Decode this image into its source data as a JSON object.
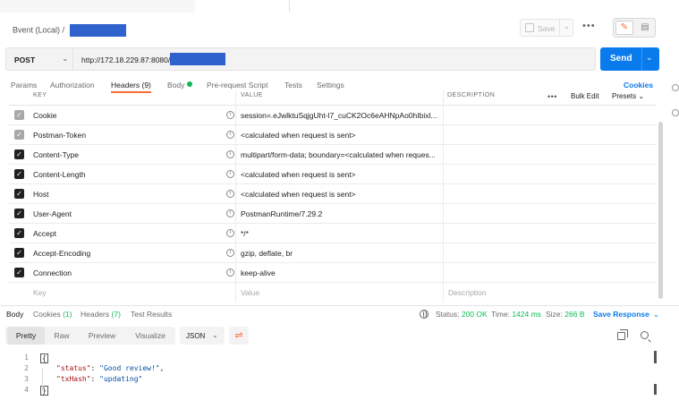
{
  "breadcrumb": {
    "collection": "Bvent (Local)",
    "separator": "/"
  },
  "toolbar": {
    "save_label": "Save"
  },
  "request": {
    "method": "POST",
    "url": "http://172.18.229.87:8080/"
  },
  "send_label": "Send",
  "request_tabs": {
    "params": "Params",
    "authorization": "Authorization",
    "headers": "Headers (9)",
    "body": "Body",
    "prerequest": "Pre-request Script",
    "tests": "Tests",
    "settings": "Settings",
    "cookies": "Cookies"
  },
  "table": {
    "columns": {
      "key": "KEY",
      "value": "VALUE",
      "description": "DESCRIPTION",
      "bulk_edit": "Bulk Edit",
      "presets": "Presets"
    },
    "rows": [
      {
        "key": "Cookie",
        "value": "session=.eJwlktuSqjgUht-l7_cuCK2Oc6eAHNpAo0hIbixl...",
        "enabled": true,
        "auto": true
      },
      {
        "key": "Postman-Token",
        "value": "<calculated when request is sent>",
        "enabled": true,
        "auto": true
      },
      {
        "key": "Content-Type",
        "value": "multipart/form-data; boundary=<calculated when reques...",
        "enabled": true,
        "auto": false
      },
      {
        "key": "Content-Length",
        "value": "<calculated when request is sent>",
        "enabled": true,
        "auto": false
      },
      {
        "key": "Host",
        "value": "<calculated when request is sent>",
        "enabled": true,
        "auto": false
      },
      {
        "key": "User-Agent",
        "value": "PostmanRuntime/7.29.2",
        "enabled": true,
        "auto": false
      },
      {
        "key": "Accept",
        "value": "*/*",
        "enabled": true,
        "auto": false
      },
      {
        "key": "Accept-Encoding",
        "value": "gzip, deflate, br",
        "enabled": true,
        "auto": false
      },
      {
        "key": "Connection",
        "value": "keep-alive",
        "enabled": true,
        "auto": false
      }
    ],
    "placeholders": {
      "key": "Key",
      "value": "Value",
      "description": "Description"
    }
  },
  "response": {
    "tabs": {
      "body": "Body",
      "cookies": "Cookies",
      "cookies_count": "(1)",
      "headers": "Headers",
      "headers_count": "(7)",
      "test_results": "Test Results"
    },
    "status_label": "Status:",
    "status_value": "200 OK",
    "time_label": "Time:",
    "time_value": "1424 ms",
    "size_label": "Size:",
    "size_value": "266 B",
    "save_response": "Save Response",
    "formats": {
      "pretty": "Pretty",
      "raw": "Raw",
      "preview": "Preview",
      "visualize": "Visualize"
    },
    "language": "JSON",
    "code": {
      "line_numbers": [
        "1",
        "2",
        "3",
        "4"
      ],
      "open_brace": "{",
      "close_brace": "}",
      "k1": "\"status\"",
      "v1": "\"Good review!\"",
      "k2": "\"txHash\"",
      "v2": "\"updating\""
    }
  }
}
